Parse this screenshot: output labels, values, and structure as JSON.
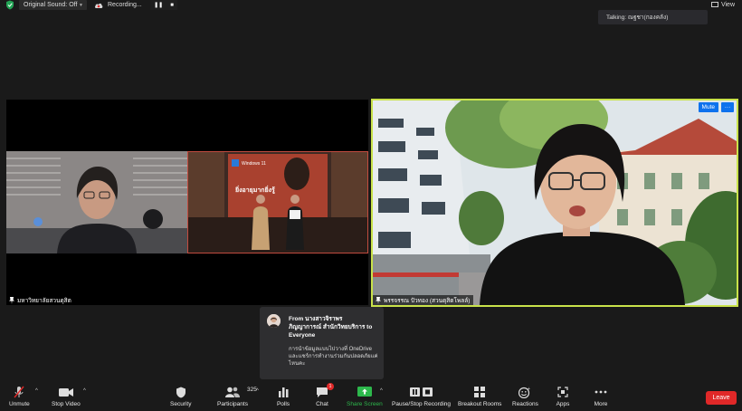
{
  "topbar": {
    "original_sound": "Original Sound: Off",
    "recording": "Recording...",
    "view": "View"
  },
  "talking": "Talking: ณฐชา(กองคลัง)",
  "participants": {
    "left_name": "มหาวิทยาลัยสวนดุสิต",
    "right_name": "พรรจรรณ ปัวทอง (สวนดุสิตโพลล์)",
    "mute_label": "Mute",
    "more_label": "···"
  },
  "slide": {
    "logo_text": "Windows 11",
    "headline": "ยิ่งอายุมากยิ่งรู้"
  },
  "chat": {
    "from_line": "From นางสาวจิราพร",
    "from_line2": "ภิญญาการณ์ สำนักวิทยบริการ to",
    "from_line3": "Everyone",
    "message_line1": "การนำข้อมูลแบบไปวางที่ OneDrive",
    "message_line2": "และแชร์การทำงานร่วมกันปลอดภัยแค่",
    "message_line3": "ไหนคะ"
  },
  "toolbar": {
    "unmute": "Unmute",
    "stop_video": "Stop Video",
    "security": "Security",
    "participants": "Participants",
    "participant_count": "325",
    "polls": "Polls",
    "chat": "Chat",
    "chat_badge": "1",
    "share_screen": "Share Screen",
    "pause_recording": "Pause/Stop Recording",
    "breakout": "Breakout Rooms",
    "reactions": "Reactions",
    "apps": "Apps",
    "more": "More",
    "leave": "Leave"
  },
  "colors": {
    "active_speaker_border": "#c9e24a",
    "accent_blue": "#0e72ed",
    "leave_red": "#e02828",
    "share_green": "#2db84c"
  }
}
